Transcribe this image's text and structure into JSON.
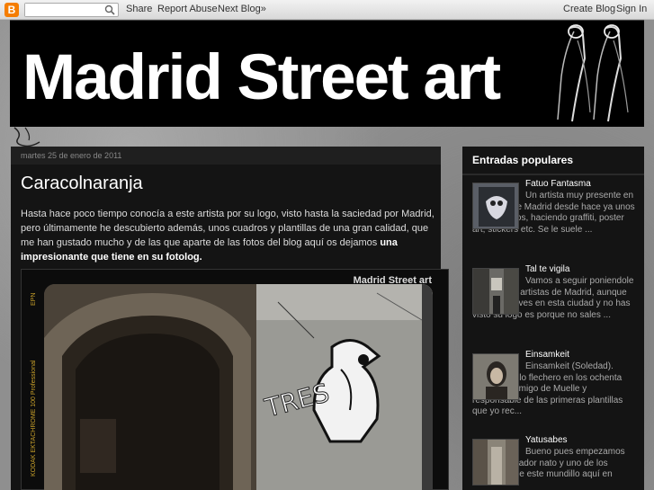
{
  "navbar": {
    "logo_letter": "B",
    "search_placeholder": "",
    "share": "Share",
    "report_abuse": "Report Abuse",
    "next_blog": "Next Blog»",
    "create_blog": "Create Blog",
    "sign_in": "Sign In"
  },
  "header": {
    "title": "Madrid Street art"
  },
  "post": {
    "date": "martes 25 de enero de 2011",
    "title": "Caracolnaranja",
    "body": "Hasta hace poco tiempo conocía a este artista por su logo, visto hasta la saciedad por Madrid, pero últimamente he descubierto además, unos cuadros y plantillas de una gran calidad, que me han gustado mucho y de las que aparte de las fotos del blog aquí os dejamos ",
    "body_link": "una impresionante que tiene en su fotolog.",
    "photo_caption": "Madrid Street art",
    "film_top": "EPN",
    "film_bottom": "KODAK EKTACHROME 100 Professional",
    "photo_graffiti": "TRES"
  },
  "sidebar": {
    "title": "Entradas populares",
    "items": [
      {
        "name": "Fatuo Fantasma",
        "snippet": "Un artista muy presente en las calles de Madrid desde hace ya unos cuantos años, haciendo graffiti, poster art, stickers etc. Se le suele ..."
      },
      {
        "name": "Tal te vigila",
        "snippet": "Vamos a seguir poniendole \"cara\" a los artistas de Madrid, aunque con Tal si vives en esta ciudad y no has visto su logo es porque no sales ..."
      },
      {
        "name": "Einsamkeit",
        "snippet": "Einsamkeit (Soledad). Escritor estilo flechero en los ochenta (Larry88), amigo de Muelle y responsable de las primeras plantillas que yo rec..."
      },
      {
        "name": "Yatusabes",
        "snippet": "Bueno pues empezamos con un plagador nato y uno de los veteranos de este mundillo aquí en"
      }
    ]
  },
  "colors": {
    "background": "#8f8f8f",
    "panel": "#141414",
    "navbar": "#e6e6e6",
    "blogger_orange": "#f57d00"
  }
}
